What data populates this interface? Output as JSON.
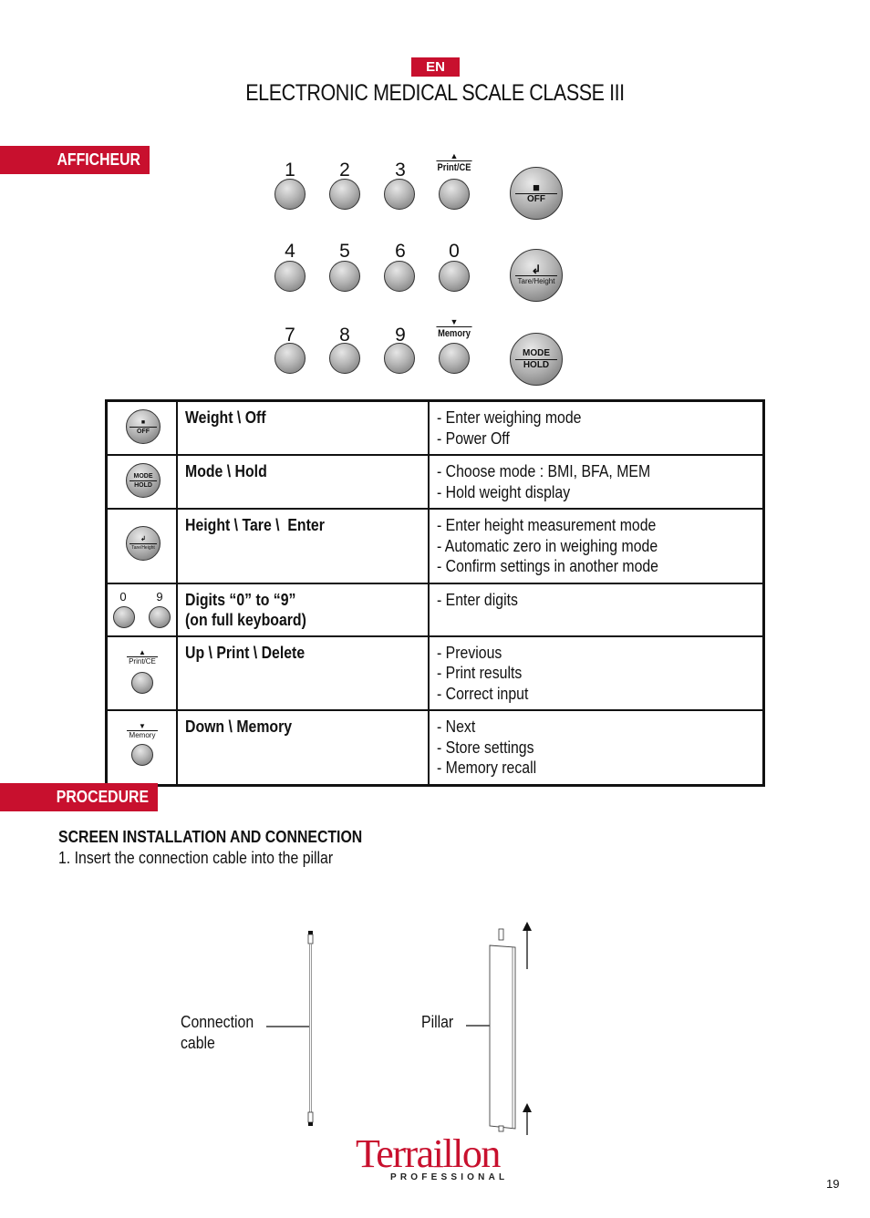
{
  "header": {
    "language_badge": "EN",
    "title": "ELECTRONIC MEDICAL SCALE CLASSE III"
  },
  "sections": {
    "display": "AFFICHEUR",
    "procedure": "PROCEDURE"
  },
  "keypad": {
    "digits_row1": [
      "1",
      "2",
      "3"
    ],
    "digits_row2": [
      "4",
      "5",
      "6",
      "0"
    ],
    "digits_row3": [
      "7",
      "8",
      "9"
    ],
    "print_label": "Print/CE",
    "memory_label": "Memory",
    "up_arrow": "▲",
    "down_arrow": "▼",
    "off_key": {
      "icon": "weight-icon",
      "label": "OFF"
    },
    "tare_key": {
      "icon": "enter-arrow-icon",
      "label": "Tare/Height"
    },
    "mode_key": {
      "top": "MODE",
      "bottom": "HOLD"
    }
  },
  "key_table": {
    "rows": [
      {
        "icon": "off-key",
        "name": "Weight \\ Off",
        "desc": [
          "- Enter weighing mode",
          "- Power Off"
        ]
      },
      {
        "icon": "mode-hold-key",
        "name": "Mode \\ Hold",
        "desc": [
          "- Choose mode : BMI, BFA, MEM",
          "- Hold weight display"
        ]
      },
      {
        "icon": "tare-height-key",
        "name": "Height \\ Tare \\  Enter",
        "desc": [
          "- Enter height measurement mode",
          "- Automatic zero in weighing mode",
          "- Confirm settings in another mode"
        ]
      },
      {
        "icon": "digit-keys",
        "name": [
          "Digits “0” to “9”",
          "(on full keyboard)"
        ],
        "desc": [
          "- Enter digits"
        ],
        "digit_labels": [
          "0",
          "9"
        ]
      },
      {
        "icon": "print-ce-key",
        "name": "Up \\ Print \\ Delete",
        "desc": [
          "- Previous",
          "- Print results",
          "- Correct input"
        ]
      },
      {
        "icon": "memory-key",
        "name": "Down \\ Memory",
        "desc": [
          "- Next",
          "- Store settings",
          "- Memory recall"
        ]
      }
    ]
  },
  "procedure": {
    "heading": "SCREEN INSTALLATION AND CONNECTION",
    "step1": "1. Insert the connection cable into the pillar"
  },
  "illustration": {
    "cable_caption": [
      "Connection",
      "cable"
    ],
    "pillar_caption": "Pillar"
  },
  "footer": {
    "brand": "Terraillon",
    "brand_sub": "PROFESSIONAL",
    "page_number": "19"
  },
  "colors": {
    "accent_red": "#c8102e"
  }
}
